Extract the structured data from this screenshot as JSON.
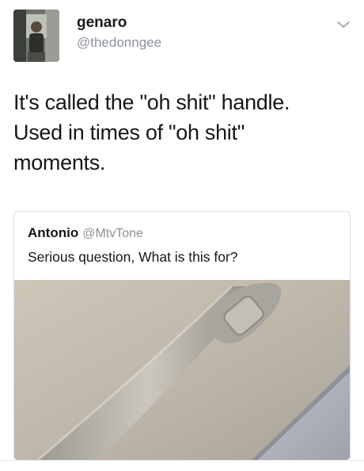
{
  "tweet": {
    "author": {
      "name": "genaro",
      "handle": "@thedonngee"
    },
    "text_lines": [
      "It's called the \"oh shit\" handle.",
      "Used in times of \"oh shit\"",
      "moments."
    ]
  },
  "quoted_tweet": {
    "author": {
      "name": "Antonio",
      "handle": "@MtvTone"
    },
    "text": "Serious question, What is this for?"
  },
  "icons": {
    "menu": "chevron-down-icon"
  },
  "colors": {
    "handle_gray": "#8a9198",
    "border": "#d9dee3",
    "text": "#161616"
  }
}
